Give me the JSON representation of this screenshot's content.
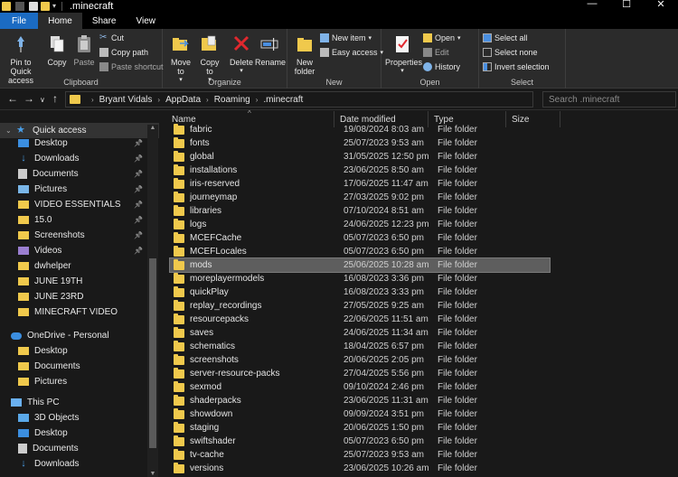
{
  "window": {
    "title": ".minecraft",
    "controls": [
      "—",
      "☐",
      "✕"
    ]
  },
  "tabs": [
    {
      "label": "File",
      "kind": "file"
    },
    {
      "label": "Home",
      "kind": "active"
    },
    {
      "label": "Share",
      "kind": ""
    },
    {
      "label": "View",
      "kind": ""
    }
  ],
  "ribbon": {
    "clipboard": {
      "label": "Clipboard",
      "pin": "Pin to Quick access",
      "copy": "Copy",
      "paste": "Paste",
      "cut": "Cut",
      "copy_path": "Copy path",
      "paste_shortcut": "Paste shortcut"
    },
    "organize": {
      "label": "Organize",
      "move_to": "Move to",
      "copy_to": "Copy to",
      "delete": "Delete",
      "rename": "Rename"
    },
    "new": {
      "label": "New",
      "new_folder": "New folder",
      "new_item": "New item",
      "easy_access": "Easy access"
    },
    "open": {
      "label": "Open",
      "properties": "Properties",
      "open": "Open",
      "edit": "Edit",
      "history": "History"
    },
    "select": {
      "label": "Select",
      "select_all": "Select all",
      "select_none": "Select none",
      "invert": "Invert selection"
    }
  },
  "address": {
    "crumbs": [
      "Bryant Vidals",
      "AppData",
      "Roaming",
      ".minecraft"
    ],
    "search_placeholder": "Search .minecraft"
  },
  "nav": {
    "quick_access": "Quick access",
    "items": [
      {
        "label": "Desktop",
        "pinned": true
      },
      {
        "label": "Downloads",
        "pinned": true
      },
      {
        "label": "Documents",
        "pinned": true
      },
      {
        "label": "Pictures",
        "pinned": true
      },
      {
        "label": "VIDEO ESSENTIALS",
        "pinned": true
      },
      {
        "label": "15.0",
        "pinned": true
      },
      {
        "label": "Screenshots",
        "pinned": true
      },
      {
        "label": "Videos",
        "pinned": true
      },
      {
        "label": "dwhelper",
        "pinned": false
      },
      {
        "label": "JUNE 19TH",
        "pinned": false
      },
      {
        "label": "JUNE 23RD",
        "pinned": false
      },
      {
        "label": "MINECRAFT VIDEO",
        "pinned": false
      }
    ],
    "onedrive": "OneDrive - Personal",
    "onedrive_items": [
      "Desktop",
      "Documents",
      "Pictures"
    ],
    "this_pc": "This PC",
    "pc_items": [
      "3D Objects",
      "Desktop",
      "Documents",
      "Downloads"
    ]
  },
  "columns": {
    "name": "Name",
    "date": "Date modified",
    "type": "Type",
    "size": "Size"
  },
  "files": [
    {
      "name": "fabric",
      "date": "19/08/2024 8:03 am",
      "type": "File folder"
    },
    {
      "name": "fonts",
      "date": "25/07/2023 9:53 am",
      "type": "File folder"
    },
    {
      "name": "global",
      "date": "31/05/2025 12:50 pm",
      "type": "File folder"
    },
    {
      "name": "installations",
      "date": "23/06/2025 8:50 am",
      "type": "File folder"
    },
    {
      "name": "iris-reserved",
      "date": "17/06/2025 11:47 am",
      "type": "File folder"
    },
    {
      "name": "journeymap",
      "date": "27/03/2025 9:02 pm",
      "type": "File folder"
    },
    {
      "name": "libraries",
      "date": "07/10/2024 8:51 am",
      "type": "File folder"
    },
    {
      "name": "logs",
      "date": "24/06/2025 12:23 pm",
      "type": "File folder"
    },
    {
      "name": "MCEFCache",
      "date": "05/07/2023 6:50 pm",
      "type": "File folder"
    },
    {
      "name": "MCEFLocales",
      "date": "05/07/2023 6:50 pm",
      "type": "File folder"
    },
    {
      "name": "mods",
      "date": "25/06/2025 10:28 am",
      "type": "File folder",
      "selected": true
    },
    {
      "name": "moreplayermodels",
      "date": "16/08/2023 3:36 pm",
      "type": "File folder"
    },
    {
      "name": "quickPlay",
      "date": "16/08/2023 3:33 pm",
      "type": "File folder"
    },
    {
      "name": "replay_recordings",
      "date": "27/05/2025 9:25 am",
      "type": "File folder"
    },
    {
      "name": "resourcepacks",
      "date": "22/06/2025 11:51 am",
      "type": "File folder"
    },
    {
      "name": "saves",
      "date": "24/06/2025 11:34 am",
      "type": "File folder"
    },
    {
      "name": "schematics",
      "date": "18/04/2025 6:57 pm",
      "type": "File folder"
    },
    {
      "name": "screenshots",
      "date": "20/06/2025 2:05 pm",
      "type": "File folder"
    },
    {
      "name": "server-resource-packs",
      "date": "27/04/2025 5:56 pm",
      "type": "File folder"
    },
    {
      "name": "sexmod",
      "date": "09/10/2024 2:46 pm",
      "type": "File folder"
    },
    {
      "name": "shaderpacks",
      "date": "23/06/2025 11:31 am",
      "type": "File folder"
    },
    {
      "name": "showdown",
      "date": "09/09/2024 3:51 pm",
      "type": "File folder"
    },
    {
      "name": "staging",
      "date": "20/06/2025 1:50 pm",
      "type": "File folder"
    },
    {
      "name": "swiftshader",
      "date": "05/07/2023 6:50 pm",
      "type": "File folder"
    },
    {
      "name": "tv-cache",
      "date": "25/07/2023 9:53 am",
      "type": "File folder"
    },
    {
      "name": "versions",
      "date": "23/06/2025 10:26 am",
      "type": "File folder"
    }
  ],
  "colors": {
    "accent": "#1b6bc2",
    "folder": "#f0c94c",
    "selected_row": "#5e5e5e"
  }
}
